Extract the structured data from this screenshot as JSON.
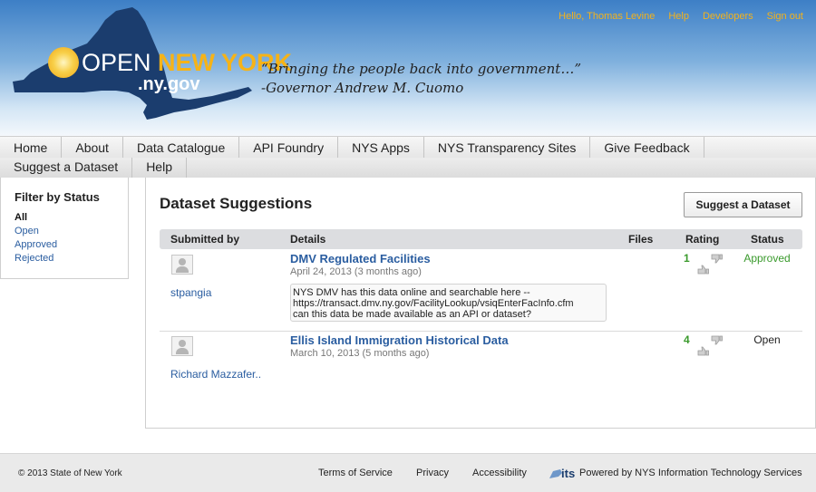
{
  "header": {
    "logo_open": "OPEN",
    "logo_ny": "NEW YORK",
    "logo_domain": ".ny.gov",
    "quote_line1": "“Bringing the people back into government…”",
    "quote_line2": "-Governor Andrew M. Cuomo",
    "user_greeting": "Hello, Thomas Levine",
    "help_link": "Help",
    "developers_link": "Developers",
    "signout_link": "Sign out",
    "accent_color": "#f4b21a"
  },
  "nav": {
    "row1": [
      "Home",
      "About",
      "Data Catalogue",
      "API Foundry",
      "NYS Apps",
      "NYS Transparency Sites",
      "Give Feedback"
    ],
    "row2": [
      "Suggest a Dataset",
      "Help"
    ]
  },
  "sidebar": {
    "title": "Filter by Status",
    "items": [
      "All",
      "Open",
      "Approved",
      "Rejected"
    ],
    "active": "All"
  },
  "main": {
    "title": "Dataset Suggestions",
    "suggest_button": "Suggest a Dataset",
    "columns": [
      "Submitted by",
      "Details",
      "Files",
      "Rating",
      "Status"
    ],
    "rows": [
      {
        "submitter": "stpangia",
        "title": "DMV Regulated Facilities",
        "date": "April 24, 2013 (3 months ago)",
        "comment": "NYS DMV has this data online and searchable here --\nhttps://transact.dmv.ny.gov/FacilityLookup/vsiqEnterFacInfo.cfm\ncan this data be made available as an API or dataset?",
        "rating": "1",
        "status": "Approved"
      },
      {
        "submitter": "Richard Mazzafer..",
        "title": "Ellis Island Immigration Historical Data",
        "date": "March 10, 2013 (5 months ago)",
        "comment": "",
        "rating": "4",
        "status": "Open"
      }
    ]
  },
  "footer": {
    "copyright": "© 2013 State of New York",
    "terms": "Terms of Service",
    "privacy": "Privacy",
    "accessibility": "Accessibility",
    "logo_text": "its",
    "powered": "Powered by NYS Information Technology Services"
  }
}
